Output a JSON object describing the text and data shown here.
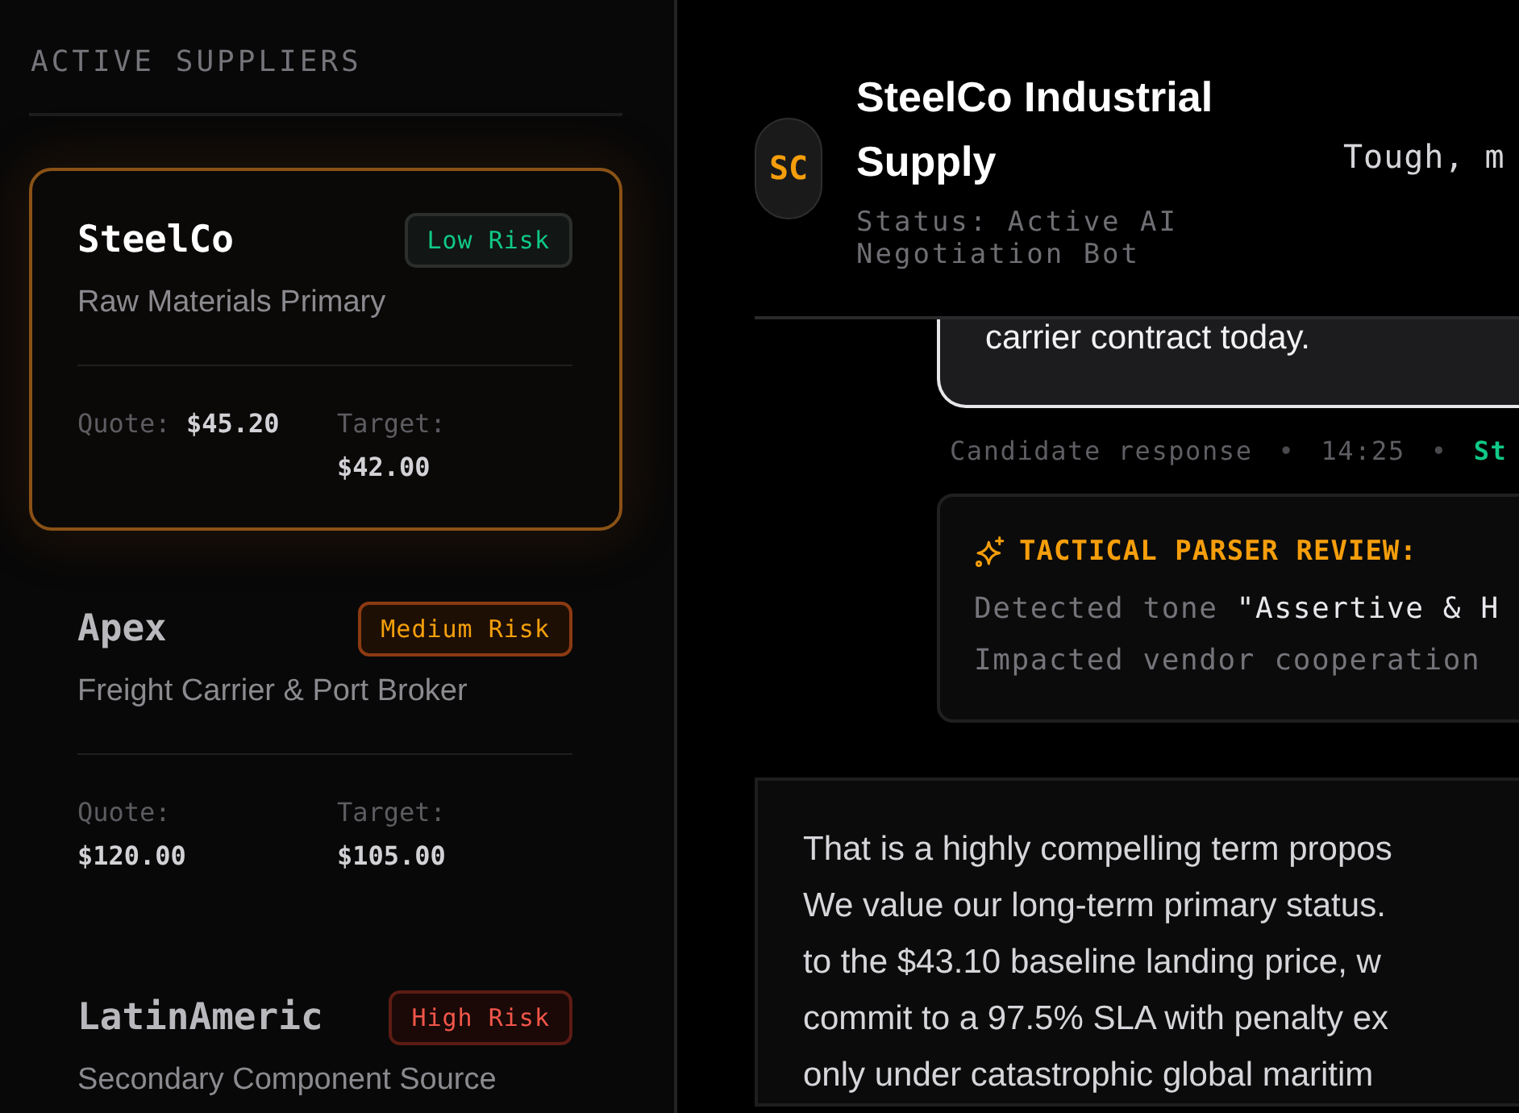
{
  "sidebar": {
    "heading": "ACTIVE SUPPLIERS",
    "suppliers": [
      {
        "name": "SteelCo",
        "kind": "low",
        "risk_label": "Low Risk",
        "category": "Raw Materials Primary",
        "quote": {
          "label": "Quote:",
          "value": "$45.20"
        },
        "target": {
          "label": "Target:",
          "value": "$42.00"
        },
        "selected": true
      },
      {
        "name": "Apex",
        "kind": "medium",
        "risk_label": "Medium Risk",
        "category": "Freight Carrier & Port Broker",
        "quote": {
          "label": "Quote:",
          "value": "$120.00"
        },
        "target": {
          "label": "Target:",
          "value": "$105.00"
        },
        "selected": false
      },
      {
        "name": "LatinAmeric",
        "kind": "high",
        "risk_label": "High Risk",
        "category": "Secondary Component Source",
        "selected": false
      }
    ]
  },
  "header": {
    "avatar_initials": "SC",
    "title": "SteelCo Industrial Supply",
    "status": "Status: Active AI Negotiation Bot",
    "note": "Tough, m"
  },
  "chat": {
    "previous_message": "carrier contract today.",
    "meta": [
      {
        "kind": "sender",
        "text": "Candidate response"
      },
      {
        "kind": "separator",
        "text": "•"
      },
      {
        "kind": "time",
        "text": "14:25"
      },
      {
        "kind": "separator",
        "text": "•"
      },
      {
        "kind": "status",
        "text": "St"
      }
    ],
    "review": {
      "title": "TACTICAL PARSER REVIEW:",
      "lines": [
        {
          "parts": [
            {
              "text": "Detected tone ",
              "highlight": false
            },
            {
              "text": "\"Assertive & H",
              "highlight": true
            }
          ]
        },
        {
          "parts": [
            {
              "text": "Impacted vendor cooperation",
              "highlight": false
            }
          ]
        }
      ]
    },
    "reply": {
      "lines": [
        "That is a highly compelling term propos",
        "We value our long-term primary status.",
        "to the $43.10 baseline landing price, w",
        "commit to a 97.5% SLA with penalty ex",
        "only under catastrophic global maritim"
      ]
    }
  }
}
